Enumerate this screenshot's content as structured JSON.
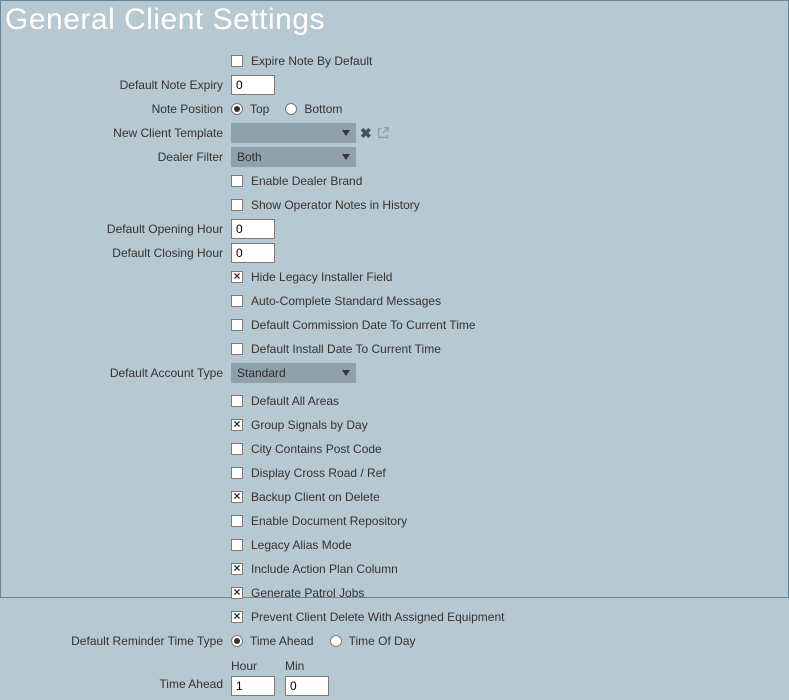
{
  "title": "General Client Settings",
  "labels": {
    "default_note_expiry": "Default Note Expiry",
    "note_position": "Note Position",
    "new_client_template": "New Client Template",
    "dealer_filter": "Dealer Filter",
    "default_opening_hour": "Default Opening Hour",
    "default_closing_hour": "Default Closing Hour",
    "default_account_type": "Default Account Type",
    "default_reminder_time_type": "Default Reminder Time Type",
    "time_ahead": "Time Ahead",
    "hour": "Hour",
    "min": "Min"
  },
  "checkboxes": {
    "expire_note_by_default": {
      "label": "Expire Note By Default",
      "checked": false
    },
    "enable_dealer_brand": {
      "label": "Enable Dealer Brand",
      "checked": false
    },
    "show_operator_notes": {
      "label": "Show Operator Notes in History",
      "checked": false
    },
    "hide_legacy_installer": {
      "label": "Hide Legacy Installer Field",
      "checked": true
    },
    "auto_complete_msgs": {
      "label": "Auto-Complete Standard Messages",
      "checked": false
    },
    "default_commission_date": {
      "label": "Default Commission Date To Current Time",
      "checked": false
    },
    "default_install_date": {
      "label": "Default Install Date To Current Time",
      "checked": false
    },
    "default_all_areas": {
      "label": "Default All Areas",
      "checked": false
    },
    "group_signals_by_day": {
      "label": "Group Signals by Day",
      "checked": true
    },
    "city_contains_post_code": {
      "label": "City Contains Post Code",
      "checked": false
    },
    "display_cross_road": {
      "label": "Display Cross Road / Ref",
      "checked": false
    },
    "backup_client_on_delete": {
      "label": "Backup Client on Delete",
      "checked": true
    },
    "enable_doc_repo": {
      "label": "Enable Document Repository",
      "checked": false
    },
    "legacy_alias_mode": {
      "label": "Legacy Alias Mode",
      "checked": false
    },
    "include_action_plan": {
      "label": "Include Action Plan Column",
      "checked": true
    },
    "generate_patrol_jobs": {
      "label": "Generate Patrol Jobs",
      "checked": true
    },
    "prevent_client_delete": {
      "label": "Prevent Client Delete With Assigned Equipment",
      "checked": true
    }
  },
  "radios": {
    "note_position": {
      "top": "Top",
      "bottom": "Bottom",
      "selected": "top"
    },
    "reminder_type": {
      "time_ahead": "Time Ahead",
      "time_of_day": "Time Of Day",
      "selected": "time_ahead"
    }
  },
  "dropdowns": {
    "new_client_template": "",
    "dealer_filter": "Both",
    "default_account_type": "Standard"
  },
  "inputs": {
    "default_note_expiry": "0",
    "default_opening_hour": "0",
    "default_closing_hour": "0",
    "time_ahead_hour": "1",
    "time_ahead_min": "0"
  }
}
